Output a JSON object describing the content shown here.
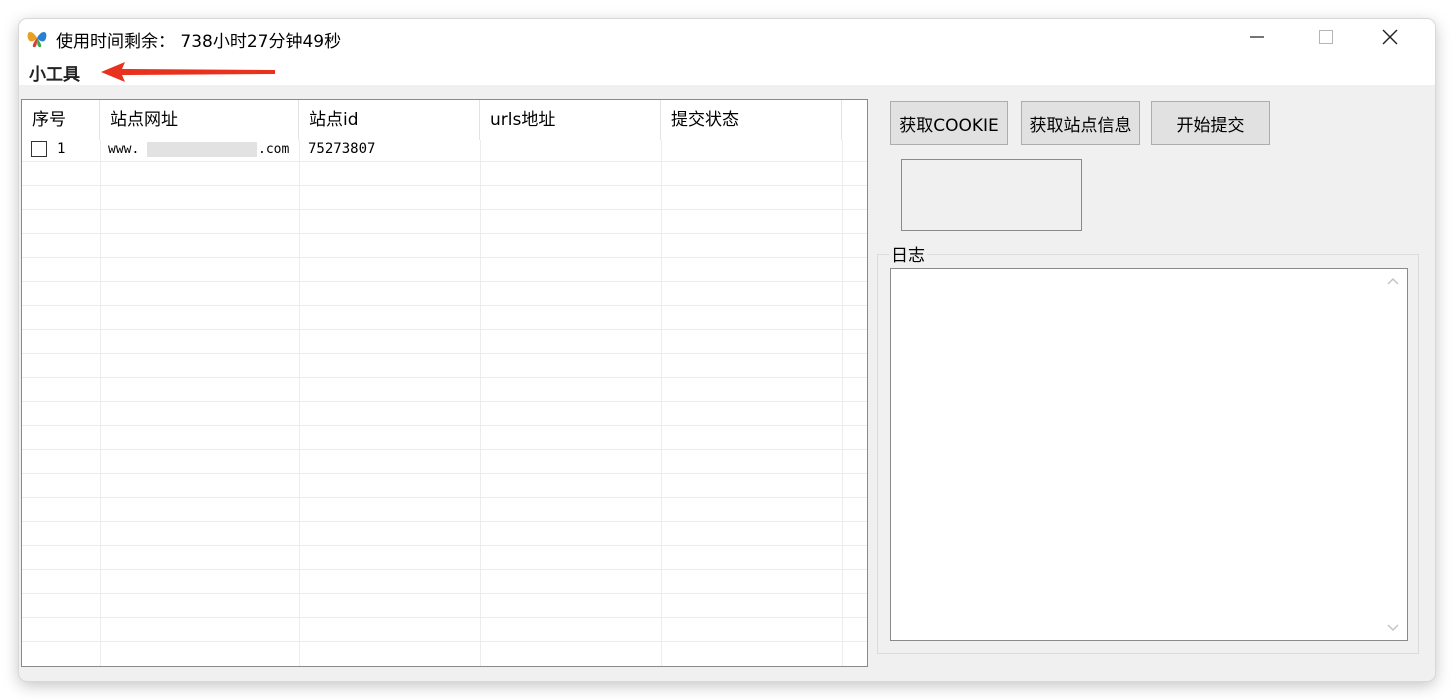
{
  "window": {
    "title": "使用时间剩余： 738小时27分钟49秒",
    "icon": "colorful-butterfly-icon"
  },
  "menu": {
    "items": [
      "小工具"
    ]
  },
  "table": {
    "columns": [
      "序号",
      "站点网址",
      "站点id",
      "urls地址",
      "提交状态"
    ],
    "rows": [
      {
        "index": "1",
        "checked": false,
        "url_prefix": "www.",
        "url_suffix": ".com",
        "site_id": "75273807",
        "urls": "",
        "status": ""
      }
    ]
  },
  "buttons": {
    "get_cookie": "获取COOKIE",
    "get_site_info": "获取站点信息",
    "start_submit": "开始提交"
  },
  "log": {
    "label": "日志",
    "content": ""
  },
  "annotation": {
    "arrow_color": "#e8321e"
  }
}
